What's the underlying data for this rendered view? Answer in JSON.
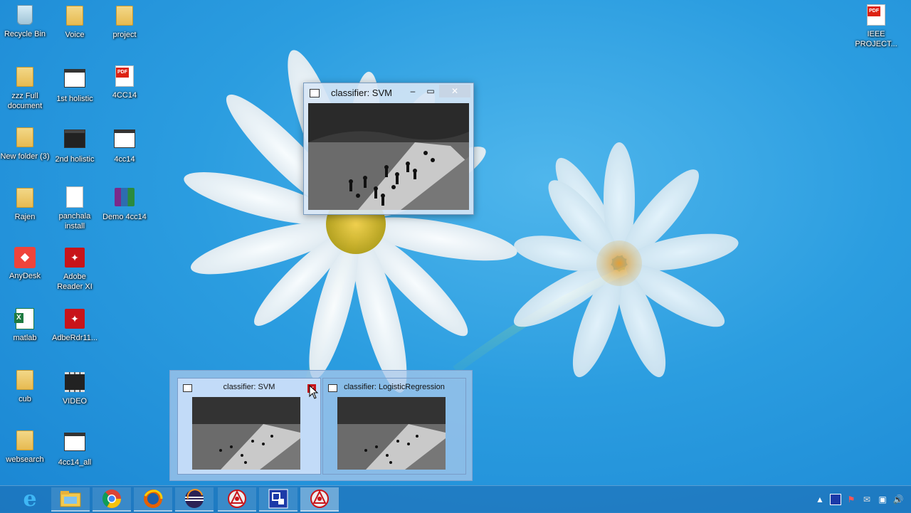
{
  "desktop": {
    "icons_col1": [
      {
        "label": "Recycle Bin",
        "type": "recycle"
      },
      {
        "label": "zzz Full document",
        "type": "folder"
      },
      {
        "label": "New folder (3)",
        "type": "folder"
      },
      {
        "label": "Rajen",
        "type": "folder"
      },
      {
        "label": "AnyDesk",
        "type": "anydesk"
      },
      {
        "label": "matlab",
        "type": "xls"
      },
      {
        "label": "cub",
        "type": "folder"
      },
      {
        "label": "websearch",
        "type": "folder"
      }
    ],
    "icons_col2": [
      {
        "label": "Voice",
        "type": "folder"
      },
      {
        "label": "1st holistic",
        "type": "winbox"
      },
      {
        "label": "2nd holistic",
        "type": "winbox-dark"
      },
      {
        "label": "panchala install",
        "type": "doc"
      },
      {
        "label": "Adobe Reader XI",
        "type": "adobe"
      },
      {
        "label": "AdbeRdr11...",
        "type": "adobe"
      },
      {
        "label": "VIDEO",
        "type": "video"
      },
      {
        "label": "4cc14_all",
        "type": "winbox"
      }
    ],
    "icons_col3": [
      {
        "label": "project",
        "type": "folder"
      },
      {
        "label": "4CC14",
        "type": "pdf"
      },
      {
        "label": "4cc14",
        "type": "winbox"
      },
      {
        "label": "Demo 4cc14",
        "type": "rar"
      }
    ],
    "icon_right": {
      "label": "IEEE PROJECT...",
      "type": "pdf"
    }
  },
  "window": {
    "title": "classifier: SVM",
    "minimize": "‒",
    "maximize": "▭",
    "close": "✕"
  },
  "thumbnails": [
    {
      "title": "classifier: SVM",
      "active": true,
      "close": "✕"
    },
    {
      "title": "classifier: LogisticRegression",
      "active": false
    }
  ],
  "taskbar": {
    "apps": [
      {
        "name": "internet-explorer",
        "glyph": "e"
      },
      {
        "name": "file-explorer",
        "glyph": ""
      },
      {
        "name": "chrome",
        "glyph": ""
      },
      {
        "name": "firefox",
        "glyph": ""
      },
      {
        "name": "eclipse",
        "glyph": ""
      },
      {
        "name": "opencv-app",
        "glyph": ""
      },
      {
        "name": "python-window",
        "glyph": ""
      },
      {
        "name": "opencv-app-active",
        "glyph": ""
      }
    ],
    "tray_icons": [
      "chevron-up-icon",
      "network-app-icon",
      "flag-icon",
      "action-center-icon",
      "monitor-icon",
      "volume-icon"
    ]
  },
  "colors": {
    "desktop_bg": "#2b9de0",
    "taskbar": "#1e6eb4",
    "close_red": "#c8141a"
  }
}
